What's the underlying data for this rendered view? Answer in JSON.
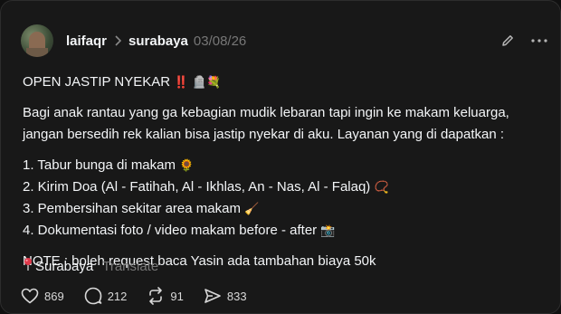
{
  "post": {
    "username": "laifaqr",
    "community": "surabaya",
    "date": "03/08/26",
    "title": "OPEN JASTIP NYEKAR",
    "title_emoji": "‼️ 🪦💐",
    "paragraph": "Bagi anak rantau yang ga kebagian mudik lebaran tapi ingin ke makam keluarga, jangan bersedih rek kalian bisa jastip nyekar di aku. Layanan yang di dapatkan :",
    "items": [
      {
        "text": "1. Tabur bunga di makam",
        "emoji": "🌻"
      },
      {
        "text": "2. Kirim Doa (Al - Fatihah, Al - Ikhlas, An - Nas, Al - Falaq)",
        "emoji": "📿"
      },
      {
        "text": "3. Pembersihan sekitar area makam",
        "emoji": "🧹"
      },
      {
        "text": "4. Dokumentasi foto / video makam before - after",
        "emoji": "📸"
      }
    ],
    "note": "NOTE : boleh request baca Yasin ada tambahan biaya 50k",
    "location": "Surabaya",
    "translate": "Translate",
    "likes": "869",
    "replies": "212",
    "reposts": "91",
    "shares": "833"
  },
  "icons": {
    "edit": "pencil-icon",
    "more": "more-dots-icon",
    "location": "pin-icon",
    "like": "heart-icon",
    "reply": "comment-icon",
    "repost": "repost-icon",
    "share": "send-icon"
  }
}
